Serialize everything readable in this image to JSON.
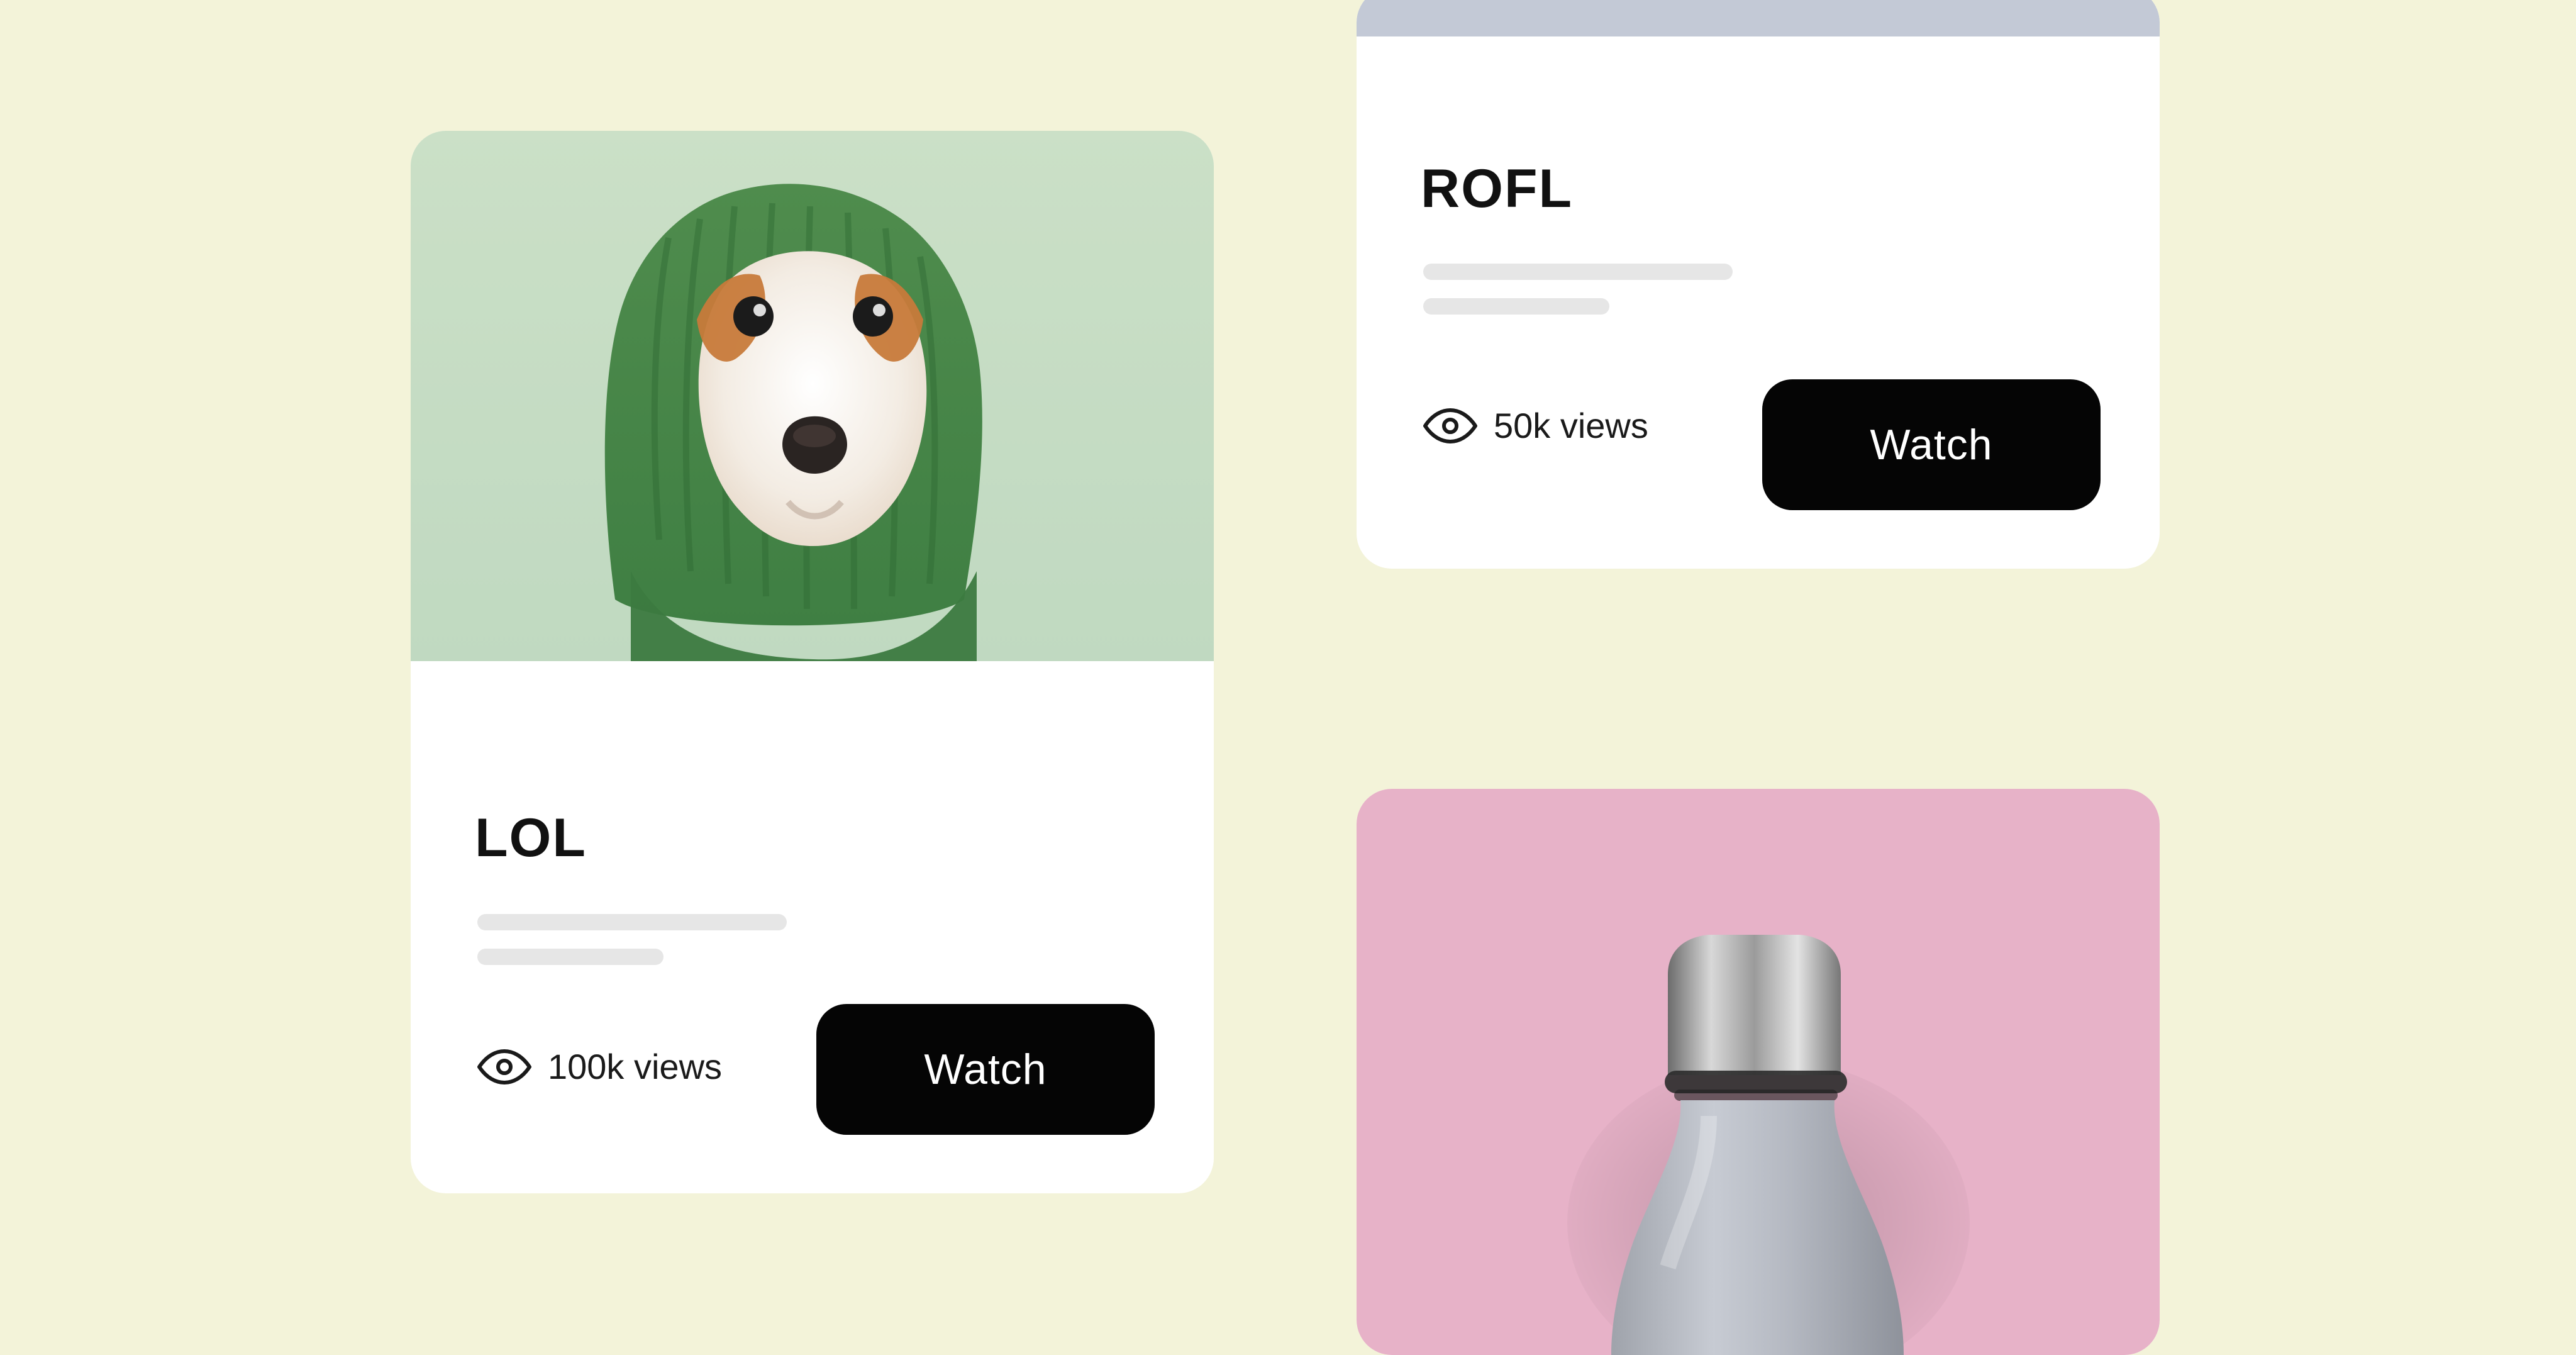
{
  "cards": [
    {
      "title": "LOL",
      "views": "100k views",
      "cta": "Watch",
      "image_icon": "dog-in-green-knit-hood-image"
    },
    {
      "title": "ROFL",
      "views": "50k views",
      "cta": "Watch"
    },
    {
      "image_icon": "bottle-image"
    }
  ],
  "colors": {
    "page_background": "#f3f3d9",
    "card_background": "#ffffff",
    "button_background": "#050505",
    "button_text": "#ffffff",
    "skeleton": "#e6e6e6",
    "card1_image_background": "#bfd9c0",
    "card3_image_background": "#e7b2c8"
  }
}
